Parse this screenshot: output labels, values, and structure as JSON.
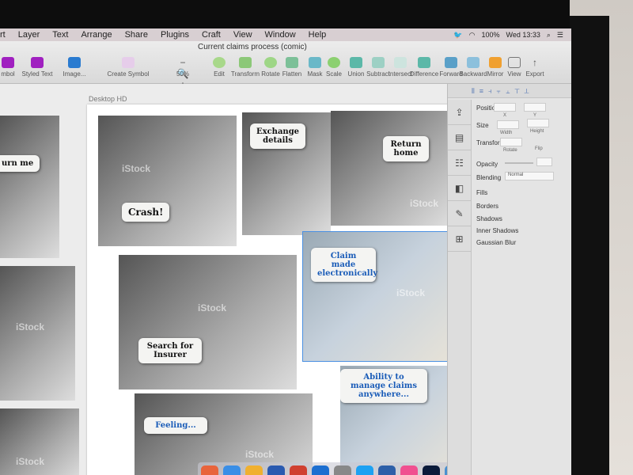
{
  "menubar": {
    "items": [
      "rt",
      "Layer",
      "Text",
      "Arrange",
      "Share",
      "Plugins",
      "Craft",
      "View",
      "Window",
      "Help"
    ],
    "battery": "100%",
    "clock": "Wed 13:33"
  },
  "document_title": "Current claims process (comic)",
  "toolbar": {
    "items": [
      "mbol",
      "Styled Text",
      "Image...",
      "Create Symbol",
      "50%",
      "Edit",
      "Transform",
      "Rotate",
      "Flatten",
      "Mask",
      "Scale",
      "Union",
      "Subtract",
      "Intersect",
      "Difference",
      "Forward",
      "Backward",
      "Mirror",
      "View",
      "Export"
    ]
  },
  "canvas": {
    "artboard_label": "Desktop HD",
    "watermark": "iStock",
    "captions": {
      "crash": "Crash!",
      "exchange": "Exchange details",
      "return": "Return home",
      "return_cut": "urn me",
      "claim": "Claim made electronically",
      "search": "Search for Insurer",
      "ability": "Ability to manage claims anywhere...",
      "feeling": "Feeling..."
    }
  },
  "inspector": {
    "position": "Position",
    "x": "X",
    "y": "Y",
    "size": "Size",
    "width": "Width",
    "height": "Height",
    "transform": "Transform",
    "rotate": "Rotate",
    "flip": "Flip",
    "opacity": "Opacity",
    "blending": "Blending",
    "blending_value": "Normal",
    "fills": "Fills",
    "borders": "Borders",
    "shadows": "Shadows",
    "inner_shadows": "Inner Shadows",
    "gaussian_blur": "Gaussian Blur"
  }
}
